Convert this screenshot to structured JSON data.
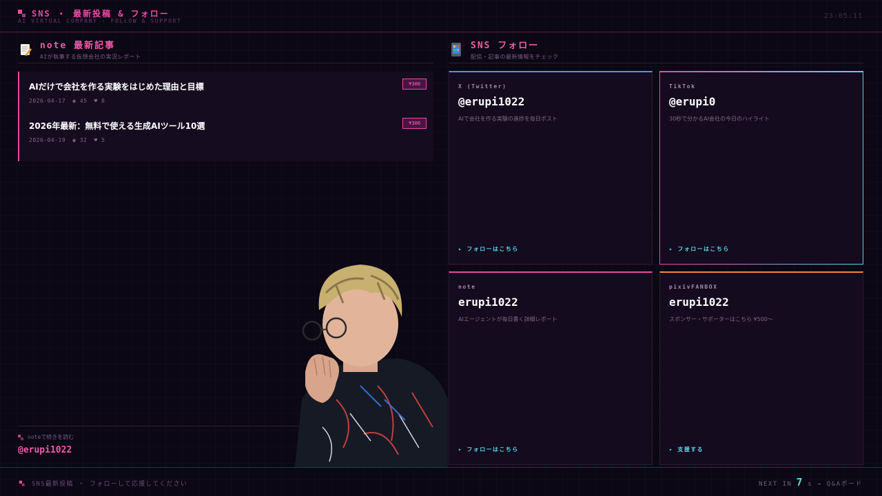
{
  "header": {
    "title": "SNS ・ 最新投稿 & フォロー",
    "subtitle": "AI VIRTUAL COMPANY · FOLLOW & SUPPORT",
    "clock": "23:05:11"
  },
  "note_section": {
    "icon": "memo-icon",
    "title": "note 最新記事",
    "subtitle": "AIが執筆する仮想会社の実況レポート",
    "articles": [
      {
        "title": "AIだけで会社を作る実験をはじめた理由と目標",
        "date": "2026-04-17",
        "views": "45",
        "likes": "8",
        "price": "¥300"
      },
      {
        "title": "2026年最新：無料で使える生成AIツール10選",
        "date": "2026-04-19",
        "views": "32",
        "likes": "5",
        "price": "¥300"
      }
    ],
    "cta_label": "noteで続きを読む",
    "cta_handle": "@erupi1022"
  },
  "sns_section": {
    "icon": "phone-icon",
    "title": "SNS フォロー",
    "subtitle": "配信・記事の最新情報をチェック",
    "cards": [
      {
        "platform": "X (Twitter)",
        "handle": "@erupi1022",
        "desc": "AIで会社を作る実験の進捗を毎日ポスト",
        "cta": "▸ フォローはこちら",
        "accent": "#4a9be0"
      },
      {
        "platform": "TikTok",
        "handle": "@erupi0",
        "desc": "30秒で分かるAI会社の今日のハイライト",
        "cta": "▸ フォローはこちら",
        "accent": "#e94aa6"
      },
      {
        "platform": "note",
        "handle": "erupi1022",
        "desc": "AIエージェントが毎日書く詳細レポート",
        "cta": "▸ フォローはこちら",
        "accent": "#e94aa6"
      },
      {
        "platform": "pixivFANBOX",
        "handle": "erupi1022",
        "desc": "スポンサー・サポーターはこちら ¥500〜",
        "cta": "▸ 支援する",
        "accent": "#f08a3a"
      }
    ]
  },
  "footer": {
    "left": "SNS最新投稿 ・ フォローして応援してください",
    "next_label": "NEXT IN",
    "next_num": "7",
    "next_unit": "s → Q&Aボード"
  },
  "colors": {
    "accent": "#e94aa6",
    "cyan": "#55d8e6",
    "bg": "#0c0714"
  }
}
